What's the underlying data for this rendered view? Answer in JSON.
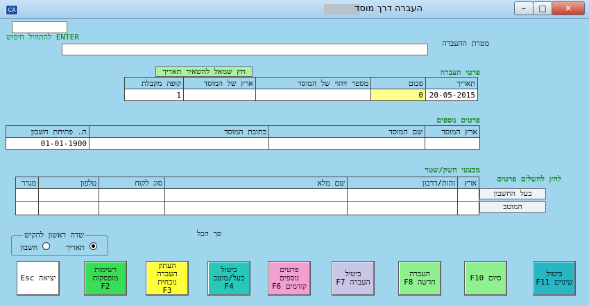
{
  "window": {
    "title": "העברה דרך מוסד",
    "minimize": "–",
    "maximize": "□",
    "close": "✕",
    "app_icon": "CA"
  },
  "search": {
    "value": "",
    "hint": "ENTER להתחיל חיפוש"
  },
  "purpose": {
    "label": "מטרת ההעברה",
    "value": ""
  },
  "transfer_details": {
    "title": "פרטי העברה",
    "hint": "חץ שמאל להשאיר תאריך",
    "headers": [
      "תאריך",
      "סכום",
      "מספר זיהוי של המוסד",
      "ארץ של המוסד",
      "קופה מקבלת"
    ],
    "values": [
      "20-05-2015",
      "0",
      "",
      "",
      "1"
    ]
  },
  "additional_details": {
    "title": "פרטים נוספים",
    "headers": [
      "ארץ המוסד",
      "שם המוסד",
      "כתובת המוסד",
      "ת. פתיחת חשבון"
    ],
    "values": [
      "",
      "",
      "",
      "01-01-1900"
    ]
  },
  "parties": {
    "title": "מבצעי השק/שטר",
    "hint": "לחץ להשלים פרטים",
    "headers": [
      "ארץ",
      "זהות/דרכון",
      "שם מלא",
      "סוג לקוח",
      "טלפון",
      "מגדר"
    ],
    "rows": [
      {
        "button": "בעל החשבון"
      },
      {
        "button": "המוטב"
      }
    ]
  },
  "total": {
    "label": "סך הכל"
  },
  "first_field": {
    "legend": "שדה ראשון להקיש",
    "option_date": "תאריך",
    "option_account": "חשבון",
    "selected": "date"
  },
  "buttons": [
    {
      "id": "cancel-changes",
      "label": "ביטול\nשינוים F11",
      "color": "#27b6c4"
    },
    {
      "id": "finish",
      "label": "סיום F10",
      "color": "#8ff08f"
    },
    {
      "id": "new-transfer",
      "label": "העברה\nחדשה F8",
      "color": "#8ff08f"
    },
    {
      "id": "cancel-transfer",
      "label": "ביטול\nהעברה F7",
      "color": "#c9c5e8"
    },
    {
      "id": "previous-details",
      "label": "פרטים\nנוספים\nקודמים F6",
      "color": "#f59ed2"
    },
    {
      "id": "cancel-owner",
      "label": "ביטול\nבעל/מוטב\nF4",
      "color": "#27c7b9"
    },
    {
      "id": "copy-current",
      "label": "העתק\nהעברה\nנוכחית\nF3",
      "color": "#ffff3a"
    },
    {
      "id": "lists",
      "label": "רשימות\nמופסקות\nF2",
      "color": "#38de55"
    },
    {
      "id": "exit",
      "label": "יציאה Esc",
      "color": "#ffffff"
    }
  ]
}
